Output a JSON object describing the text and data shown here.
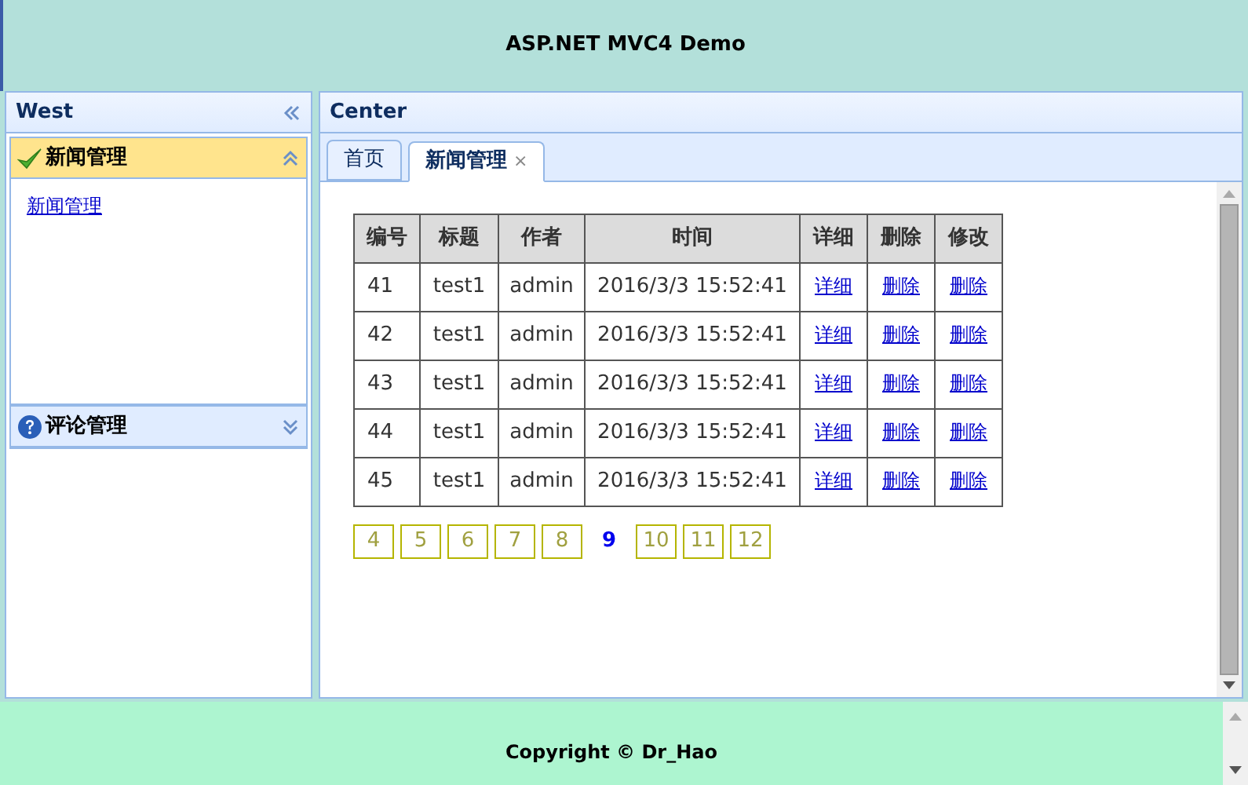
{
  "header": {
    "title": "ASP.NET MVC4 Demo"
  },
  "west": {
    "title": "West",
    "panels": [
      {
        "kind": "check",
        "title": "新闻管理",
        "expanded": true,
        "links": [
          "新闻管理"
        ]
      },
      {
        "kind": "help",
        "title": "评论管理",
        "expanded": false
      }
    ]
  },
  "center": {
    "title": "Center",
    "tabs": [
      {
        "label": "首页",
        "selected": false
      },
      {
        "label": "新闻管理",
        "selected": true,
        "close": "×"
      }
    ],
    "table": {
      "columns": [
        "编号",
        "标题",
        "作者",
        "时间",
        "详细",
        "删除",
        "修改"
      ],
      "rows": [
        {
          "cells": [
            "41",
            "test1",
            "admin",
            "2016/3/3 15:52:41"
          ],
          "links": [
            "详细",
            "删除",
            "删除"
          ]
        },
        {
          "cells": [
            "42",
            "test1",
            "admin",
            "2016/3/3 15:52:41"
          ],
          "links": [
            "详细",
            "删除",
            "删除"
          ]
        },
        {
          "cells": [
            "43",
            "test1",
            "admin",
            "2016/3/3 15:52:41"
          ],
          "links": [
            "详细",
            "删除",
            "删除"
          ]
        },
        {
          "cells": [
            "44",
            "test1",
            "admin",
            "2016/3/3 15:52:41"
          ],
          "links": [
            "详细",
            "删除",
            "删除"
          ]
        },
        {
          "cells": [
            "45",
            "test1",
            "admin",
            "2016/3/3 15:52:41"
          ],
          "links": [
            "详细",
            "删除",
            "删除"
          ]
        }
      ]
    },
    "pager": [
      {
        "label": "4",
        "selected": false
      },
      {
        "label": "5",
        "selected": false
      },
      {
        "label": "6",
        "selected": false
      },
      {
        "label": "7",
        "selected": false
      },
      {
        "label": "8",
        "selected": false
      },
      {
        "label": "9",
        "selected": true
      },
      {
        "label": "10",
        "selected": false
      },
      {
        "label": "11",
        "selected": false
      },
      {
        "label": "12",
        "selected": false
      }
    ]
  },
  "footer": {
    "text": "Copyright © Dr_Hao"
  }
}
